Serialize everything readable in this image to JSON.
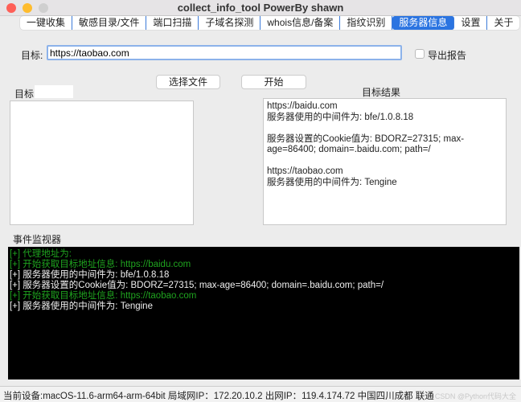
{
  "window": {
    "title": "collect_info_tool  PowerBy shawn"
  },
  "tabs": [
    {
      "label": "一键收集"
    },
    {
      "label": "敏感目录/文件"
    },
    {
      "label": "端口扫描"
    },
    {
      "label": "子域名探测"
    },
    {
      "label": "whois信息/备案"
    },
    {
      "label": "指纹识别"
    },
    {
      "label": "服务器信息",
      "active": true
    },
    {
      "label": "设置"
    },
    {
      "label": "关于"
    }
  ],
  "form": {
    "target_label": "目标:",
    "target_value": "https://taobao.com",
    "export_label": "导出报告",
    "export_checked": false,
    "select_file_button": "选择文件",
    "start_button": "开始",
    "target_list_label": "目标",
    "target_list_value": "",
    "result_label": "目标结果"
  },
  "results": [
    "https://baidu.com",
    "服务器使用的中间件为: bfe/1.0.8.18",
    "",
    "服务器设置的Cookie值为: BDORZ=27315; max-age=86400; domain=.baidu.com; path=/",
    "",
    "https://taobao.com",
    "服务器使用的中间件为: Tengine"
  ],
  "monitor": {
    "label": "事件监视器",
    "lines": [
      {
        "text": "[+] 代理地址为:",
        "color": "green"
      },
      {
        "text": "[+] 开始获取目标地址信息: https://baidu.com",
        "color": "green"
      },
      {
        "text": "[+] 服务器使用的中间件为: bfe/1.0.8.18",
        "color": "white"
      },
      {
        "text": "[+] 服务器设置的Cookie值为: BDORZ=27315; max-age=86400; domain=.baidu.com; path=/",
        "color": "white"
      },
      {
        "text": "[+] 开始获取目标地址信息: https://taobao.com",
        "color": "green"
      },
      {
        "text": "[+] 服务器使用的中间件为: Tengine",
        "color": "white"
      }
    ]
  },
  "status": {
    "text": "当前设备:macOS-11.6-arm64-arm-64bit  局域网IP：172.20.10.2  出网IP：119.4.174.72  中国四川成都 联通"
  },
  "watermark": "CSDN @Python代码大全",
  "colors": {
    "accent": "#2b74e1",
    "console_green": "#1fa31f",
    "console_bg": "#000000"
  }
}
